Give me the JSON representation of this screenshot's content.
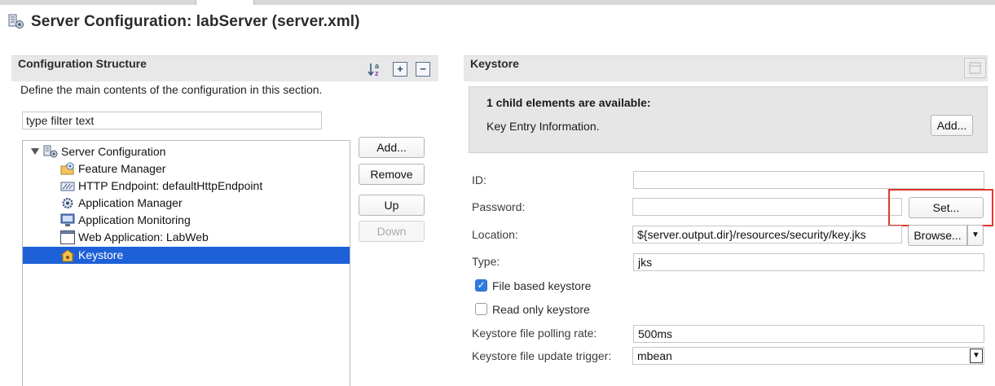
{
  "editor": {
    "title": "Server Configuration: labServer (server.xml)",
    "icon": "server-config-icon"
  },
  "left_section": {
    "title": "Configuration Structure",
    "toolbar_icons": [
      "sort-alpha-icon",
      "expand-all-icon",
      "collapse-all-icon"
    ],
    "description": "Define the main contents of the configuration in this section.",
    "filter": {
      "value": "type filter text",
      "placeholder": "type filter text"
    },
    "tree": [
      {
        "label": "Server Configuration",
        "icon": "server-config-icon",
        "expanded": true,
        "level": 0
      },
      {
        "label": "Feature Manager",
        "icon": "feature-manager-icon",
        "level": 1
      },
      {
        "label": "HTTP Endpoint: defaultHttpEndpoint",
        "icon": "http-endpoint-icon",
        "level": 1
      },
      {
        "label": "Application Manager",
        "icon": "application-manager-icon",
        "level": 1
      },
      {
        "label": "Application Monitoring",
        "icon": "application-monitoring-icon",
        "level": 1
      },
      {
        "label": "Web Application: LabWeb",
        "icon": "web-application-icon",
        "level": 1
      },
      {
        "label": "Keystore",
        "icon": "keystore-icon",
        "level": 1,
        "selected": true
      }
    ],
    "buttons": {
      "add": "Add...",
      "remove": "Remove",
      "up": "Up",
      "down": "Down"
    }
  },
  "right_section": {
    "title": "Keystore",
    "child_elements": {
      "title": "1 child elements are available:",
      "item": "Key Entry Information.",
      "add_button": "Add..."
    },
    "fields": {
      "id": {
        "label": "ID:",
        "value": ""
      },
      "password": {
        "label": "Password:",
        "value": "",
        "button": "Set..."
      },
      "location": {
        "label": "Location:",
        "value": "${server.output.dir}/resources/security/key.jks",
        "button": "Browse..."
      },
      "type": {
        "label": "Type:",
        "value": "jks"
      },
      "file_based": {
        "label": "File based keystore",
        "checked": true
      },
      "read_only": {
        "label": "Read only keystore",
        "checked": false
      },
      "polling_rate": {
        "label": "Keystore file polling rate:",
        "value": "500ms"
      },
      "update_trigger": {
        "label": "Keystore file update trigger:",
        "value": "mbean"
      }
    }
  },
  "colors": {
    "selection": "#1e60d7",
    "highlight_box": "#e0382c",
    "checkbox_checked": "#2f7ce0"
  }
}
